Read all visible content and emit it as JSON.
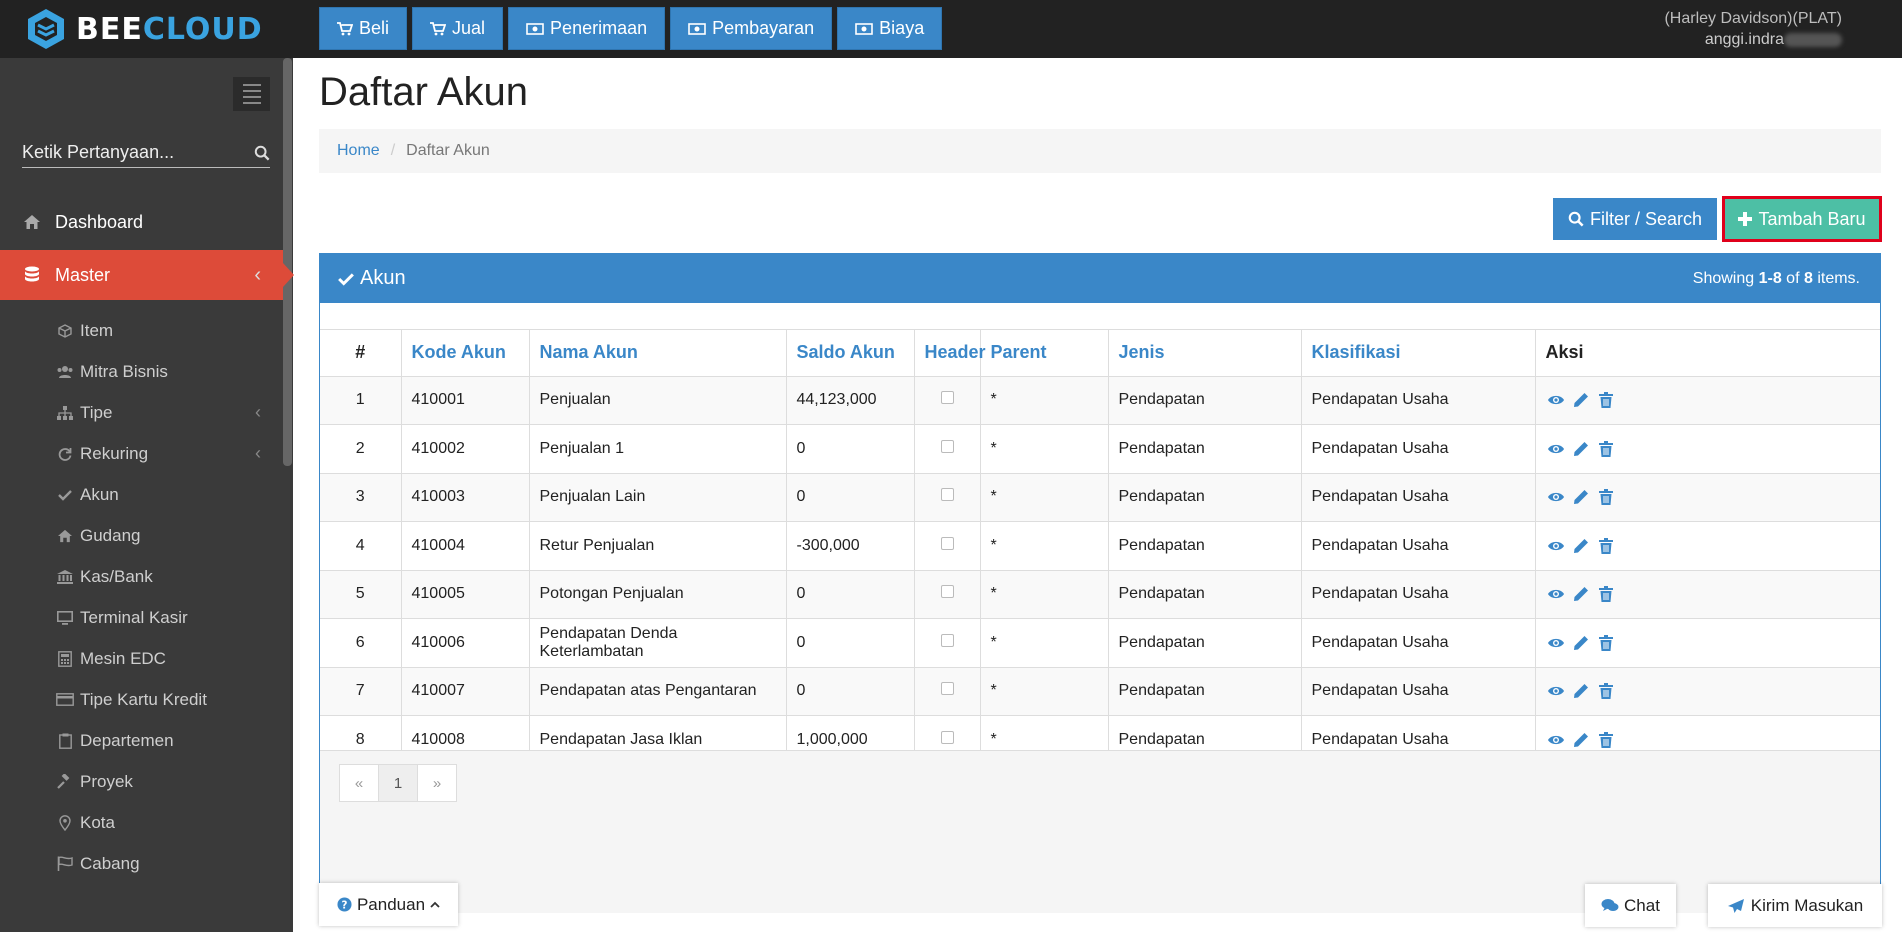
{
  "app": {
    "logo_left": "BEE",
    "logo_right": "CLOUD",
    "accent_color": "#3a87c8",
    "active_color": "#dd4b39",
    "add_color": "#4dbfa5"
  },
  "topnav": [
    {
      "label": "Beli",
      "icon": "cart-icon"
    },
    {
      "label": "Jual",
      "icon": "cart-icon"
    },
    {
      "label": "Penerimaan",
      "icon": "money-icon"
    },
    {
      "label": "Pembayaran",
      "icon": "money-icon"
    },
    {
      "label": "Biaya",
      "icon": "money-icon"
    }
  ],
  "user": {
    "company": "(Harley Davidson)(PLAT)",
    "name": "anggi.indra"
  },
  "sidebar": {
    "search_placeholder": "Ketik Pertanyaan...",
    "items": [
      {
        "label": "Dashboard",
        "icon": "home-icon"
      },
      {
        "label": "Master",
        "icon": "database-icon"
      }
    ],
    "sub_items": [
      {
        "label": "Item",
        "icon": "cube-icon"
      },
      {
        "label": "Mitra Bisnis",
        "icon": "users-icon"
      },
      {
        "label": "Tipe",
        "icon": "sitemap-icon"
      },
      {
        "label": "Rekuring",
        "icon": "refresh-icon"
      },
      {
        "label": "Akun",
        "icon": "check-icon"
      },
      {
        "label": "Gudang",
        "icon": "home-icon"
      },
      {
        "label": "Kas/Bank",
        "icon": "bank-icon"
      },
      {
        "label": "Terminal Kasir",
        "icon": "monitor-icon"
      },
      {
        "label": "Mesin EDC",
        "icon": "calculator-icon"
      },
      {
        "label": "Tipe Kartu Kredit",
        "icon": "credit-card-icon"
      },
      {
        "label": "Departemen",
        "icon": "clipboard-icon"
      },
      {
        "label": "Proyek",
        "icon": "gavel-icon"
      },
      {
        "label": "Kota",
        "icon": "map-marker-icon"
      },
      {
        "label": "Cabang",
        "icon": "flag-icon"
      }
    ]
  },
  "page": {
    "title": "Daftar Akun",
    "breadcrumb_home": "Home",
    "breadcrumb_sep": "/",
    "breadcrumb_current": "Daftar Akun",
    "filter_label": "Filter / Search",
    "add_label": "Tambah Baru"
  },
  "panel": {
    "title": "Akun",
    "summary_prefix": "Showing ",
    "summary_range": "1-8",
    "summary_of": " of ",
    "summary_total": "8",
    "summary_suffix": " items."
  },
  "table": {
    "columns": [
      "#",
      "Kode Akun",
      "Nama Akun",
      "Saldo Akun",
      "Header",
      "Parent",
      "Jenis",
      "Klasifikasi",
      "Aksi"
    ],
    "rows": [
      {
        "no": "1",
        "kode": "410001",
        "nama": "Penjualan",
        "saldo": "44,123,000",
        "parent": "*",
        "jenis": "Pendapatan",
        "klasifikasi": "Pendapatan Usaha"
      },
      {
        "no": "2",
        "kode": "410002",
        "nama": "Penjualan 1",
        "saldo": "0",
        "parent": "*",
        "jenis": "Pendapatan",
        "klasifikasi": "Pendapatan Usaha"
      },
      {
        "no": "3",
        "kode": "410003",
        "nama": "Penjualan Lain",
        "saldo": "0",
        "parent": "*",
        "jenis": "Pendapatan",
        "klasifikasi": "Pendapatan Usaha"
      },
      {
        "no": "4",
        "kode": "410004",
        "nama": "Retur Penjualan",
        "saldo": "-300,000",
        "parent": "*",
        "jenis": "Pendapatan",
        "klasifikasi": "Pendapatan Usaha"
      },
      {
        "no": "5",
        "kode": "410005",
        "nama": "Potongan Penjualan",
        "saldo": "0",
        "parent": "*",
        "jenis": "Pendapatan",
        "klasifikasi": "Pendapatan Usaha"
      },
      {
        "no": "6",
        "kode": "410006",
        "nama": "Pendapatan Denda Keterlambatan",
        "saldo": "0",
        "parent": "*",
        "jenis": "Pendapatan",
        "klasifikasi": "Pendapatan Usaha"
      },
      {
        "no": "7",
        "kode": "410007",
        "nama": "Pendapatan atas Pengantaran",
        "saldo": "0",
        "parent": "*",
        "jenis": "Pendapatan",
        "klasifikasi": "Pendapatan Usaha"
      },
      {
        "no": "8",
        "kode": "410008",
        "nama": "Pendapatan Jasa Iklan",
        "saldo": "1,000,000",
        "parent": "*",
        "jenis": "Pendapatan",
        "klasifikasi": "Pendapatan Usaha"
      }
    ]
  },
  "pager": {
    "prev": "«",
    "page": "1",
    "next": "»"
  },
  "footer": {
    "panduan_label": "Panduan",
    "chat_label": "Chat",
    "kirim_label": "Kirim Masukan"
  }
}
